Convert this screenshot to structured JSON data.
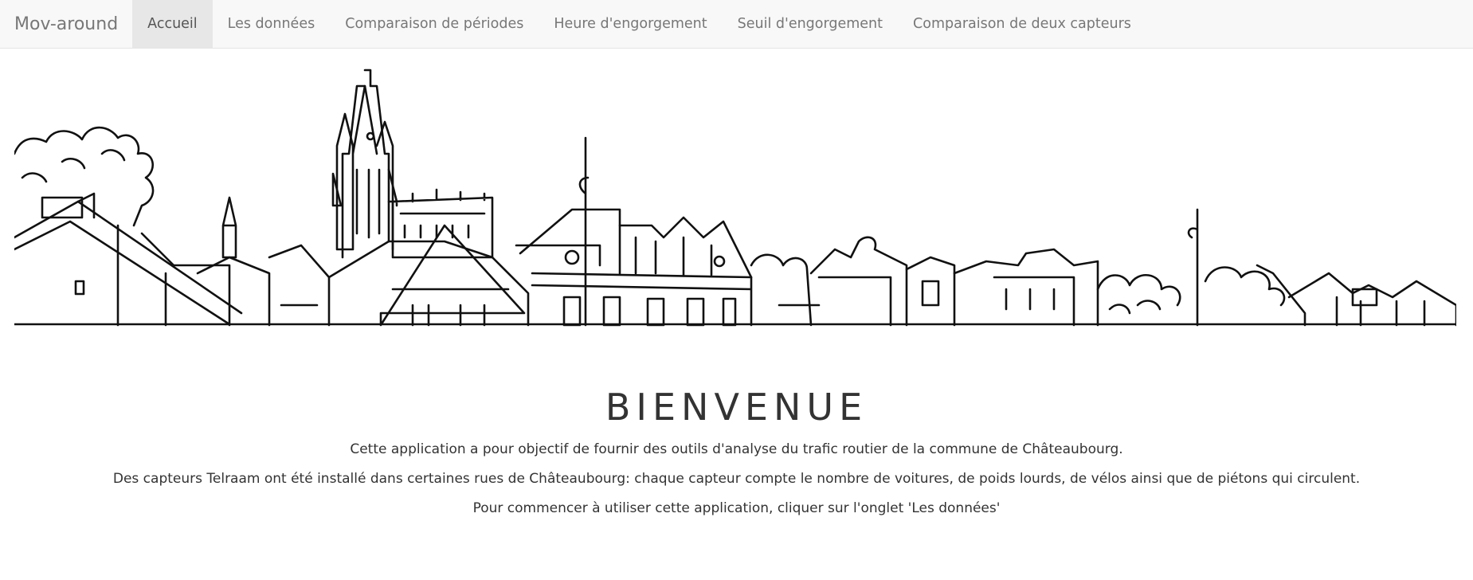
{
  "navbar": {
    "brand": "Mov-around",
    "items": [
      {
        "label": "Accueil",
        "active": true
      },
      {
        "label": "Les données",
        "active": false
      },
      {
        "label": "Comparaison de périodes",
        "active": false
      },
      {
        "label": "Heure d'engorgement",
        "active": false
      },
      {
        "label": "Seuil d'engorgement",
        "active": false
      },
      {
        "label": "Comparaison de deux capteurs",
        "active": false
      }
    ]
  },
  "hero": {
    "illustration": "chateaubourg-skyline-line-drawing"
  },
  "welcome": {
    "title": "BIENVENUE",
    "paragraphs": [
      "Cette application a pour objectif de fournir des outils d'analyse du trafic routier de la commune de Châteaubourg.",
      "Des capteurs Telraam ont été installé dans certaines rues de Châteaubourg: chaque capteur compte le nombre de voitures, de poids lourds, de vélos ainsi que de piétons qui circulent.",
      "Pour commencer à utiliser cette application, cliquer sur l'onglet 'Les données'"
    ]
  }
}
